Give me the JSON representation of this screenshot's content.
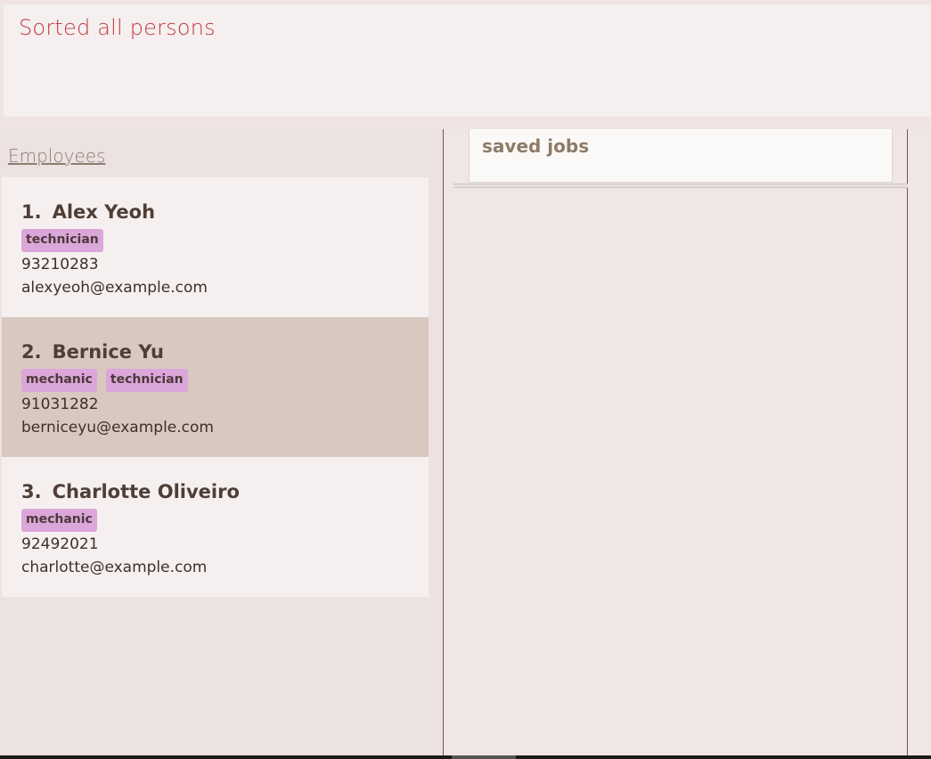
{
  "result": {
    "message": "Sorted all persons"
  },
  "employees_panel": {
    "header": "Employees",
    "persons": [
      {
        "index": "1.",
        "name": "Alex Yeoh",
        "tags": [
          "technician"
        ],
        "phone": "93210283",
        "email": "alexyeoh@example.com",
        "selected": false
      },
      {
        "index": "2.",
        "name": "Bernice Yu",
        "tags": [
          "mechanic",
          "technician"
        ],
        "phone": "91031282",
        "email": "berniceyu@example.com",
        "selected": true
      },
      {
        "index": "3.",
        "name": "Charlotte Oliveiro",
        "tags": [
          "mechanic"
        ],
        "phone": "92492021",
        "email": "charlotte@example.com",
        "selected": false
      }
    ]
  },
  "jobs_panel": {
    "title": "saved jobs"
  },
  "colors": {
    "result_text": "#c0393e",
    "tag_bg": "#dba6d9",
    "selected_card": "#d9c8c0"
  }
}
